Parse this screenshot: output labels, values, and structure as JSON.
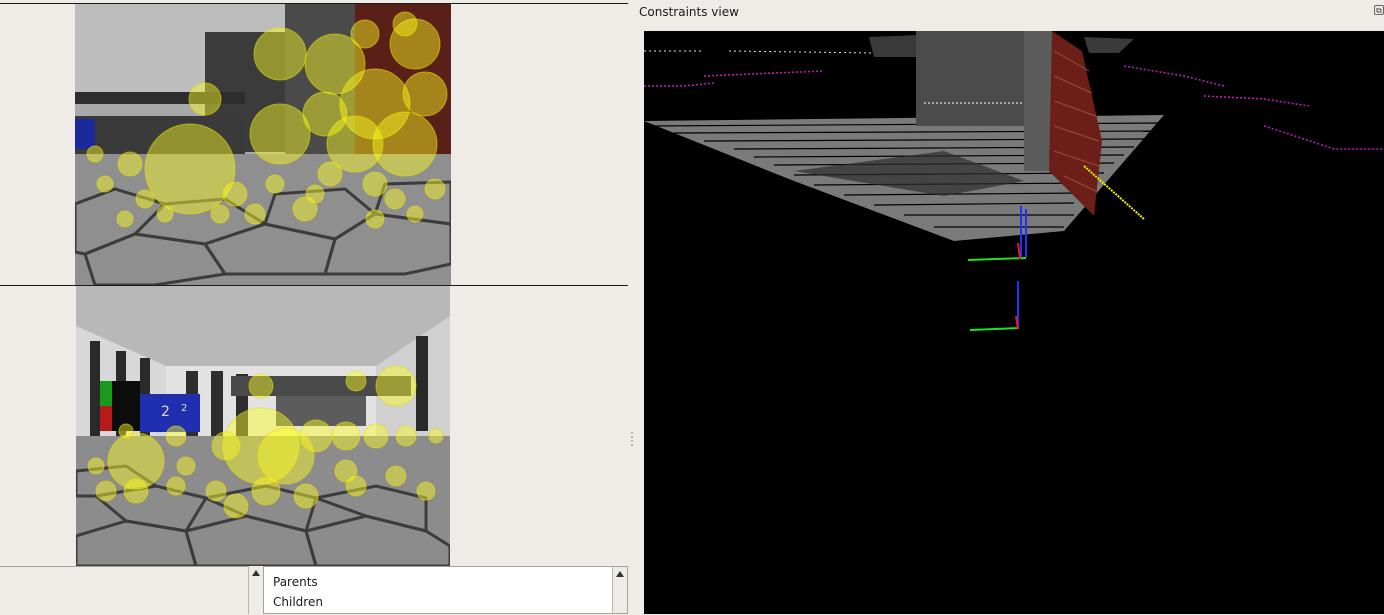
{
  "constraints_dock": {
    "title": "Constraints view",
    "float_icon": "restore-icon"
  },
  "link_list": {
    "items": [
      "Parents",
      "Children"
    ]
  },
  "scroll_icon": "scroll-up-arrow-icon"
}
